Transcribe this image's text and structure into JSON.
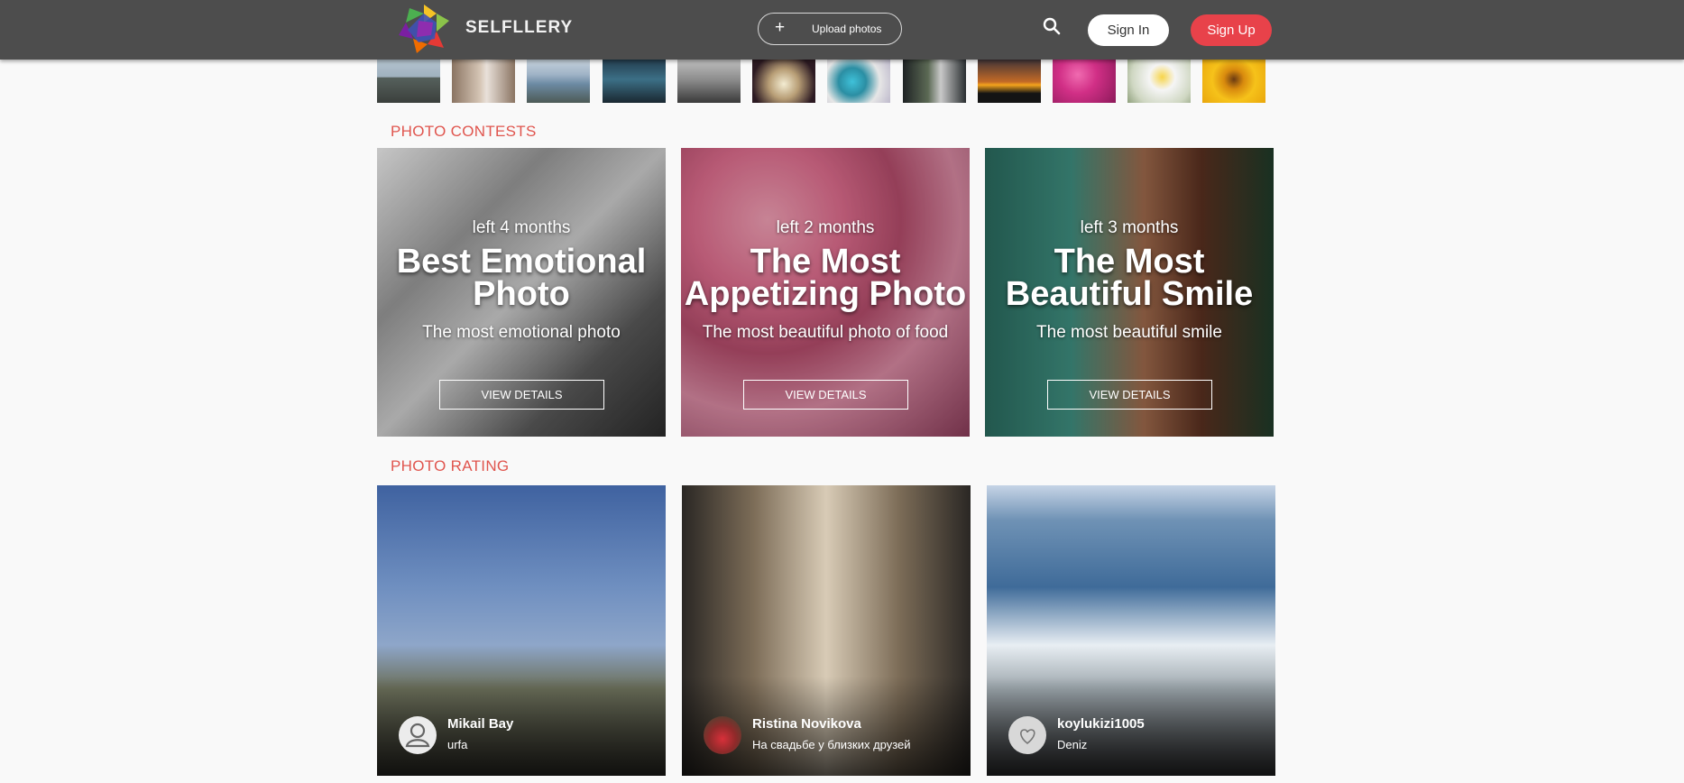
{
  "header": {
    "logo_text": "SELFLLERY",
    "upload_label": "Upload photos",
    "upload_plus": "+",
    "sign_in": "Sign In",
    "sign_up": "Sign Up",
    "colors": {
      "bar": "#4d4d4d",
      "accent": "#e8424a"
    }
  },
  "contests_title": "PHOTO CONTESTS",
  "contests": [
    {
      "time_left": "left 4 months",
      "title": "Best Emotional Photo",
      "description": "The most emotional photo",
      "button": "VIEW DETAILS"
    },
    {
      "time_left": "left 2 months",
      "title": "The Most Appetizing Photo",
      "description": "The most beautiful photo of food",
      "button": "VIEW DETAILS"
    },
    {
      "time_left": "left 3 months",
      "title": "The Most Beautiful Smile",
      "description": "The most beautiful smile",
      "button": "VIEW DETAILS"
    }
  ],
  "rating_title": "PHOTO RATING",
  "ratings": [
    {
      "user": "Mikail Bay",
      "caption": "urfa"
    },
    {
      "user": "Ristina Novikova",
      "caption": "На свадьбе у близких друзей"
    },
    {
      "user": "koylukizi1005",
      "caption": "Deniz"
    }
  ]
}
